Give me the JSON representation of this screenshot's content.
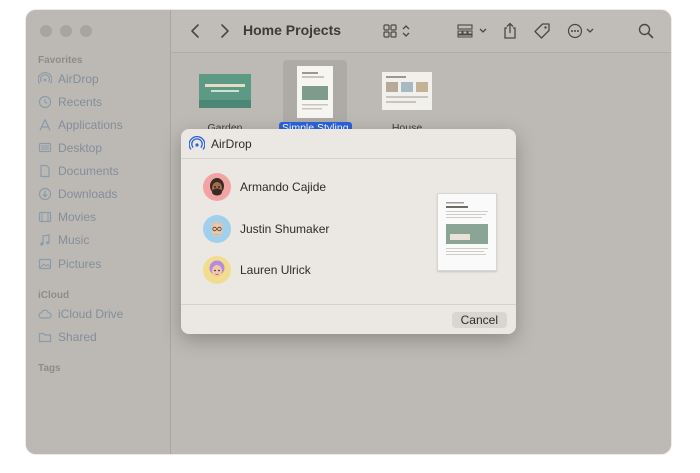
{
  "sidebar": {
    "favorites_title": "Favorites",
    "favorites": [
      {
        "label": "AirDrop",
        "icon": "airdrop-icon"
      },
      {
        "label": "Recents",
        "icon": "clock-icon"
      },
      {
        "label": "Applications",
        "icon": "applications-icon"
      },
      {
        "label": "Desktop",
        "icon": "desktop-icon"
      },
      {
        "label": "Documents",
        "icon": "document-icon"
      },
      {
        "label": "Downloads",
        "icon": "download-icon"
      },
      {
        "label": "Movies",
        "icon": "film-icon"
      },
      {
        "label": "Music",
        "icon": "music-note-icon"
      },
      {
        "label": "Pictures",
        "icon": "photo-icon"
      }
    ],
    "icloud_title": "iCloud",
    "icloud": [
      {
        "label": "iCloud Drive",
        "icon": "cloud-icon"
      },
      {
        "label": "Shared",
        "icon": "shared-folder-icon"
      }
    ],
    "tags_title": "Tags"
  },
  "toolbar": {
    "title": "Home Projects"
  },
  "files": [
    {
      "label": "Garden",
      "selected": false
    },
    {
      "label": "Simple Styling",
      "selected": true
    },
    {
      "label": "House",
      "selected": false
    }
  ],
  "airdrop_dialog": {
    "title": "AirDrop",
    "people": [
      {
        "name": "Armando Cajide",
        "avatar_color": "#f2a3a3"
      },
      {
        "name": "Justin Shumaker",
        "avatar_color": "#9fd0ee"
      },
      {
        "name": "Lauren Ulrick",
        "avatar_color": "#f2dc8e"
      }
    ],
    "cancel_label": "Cancel"
  },
  "colors": {
    "selection": "#2b63d8",
    "sidebar_text": "#838e9a"
  }
}
